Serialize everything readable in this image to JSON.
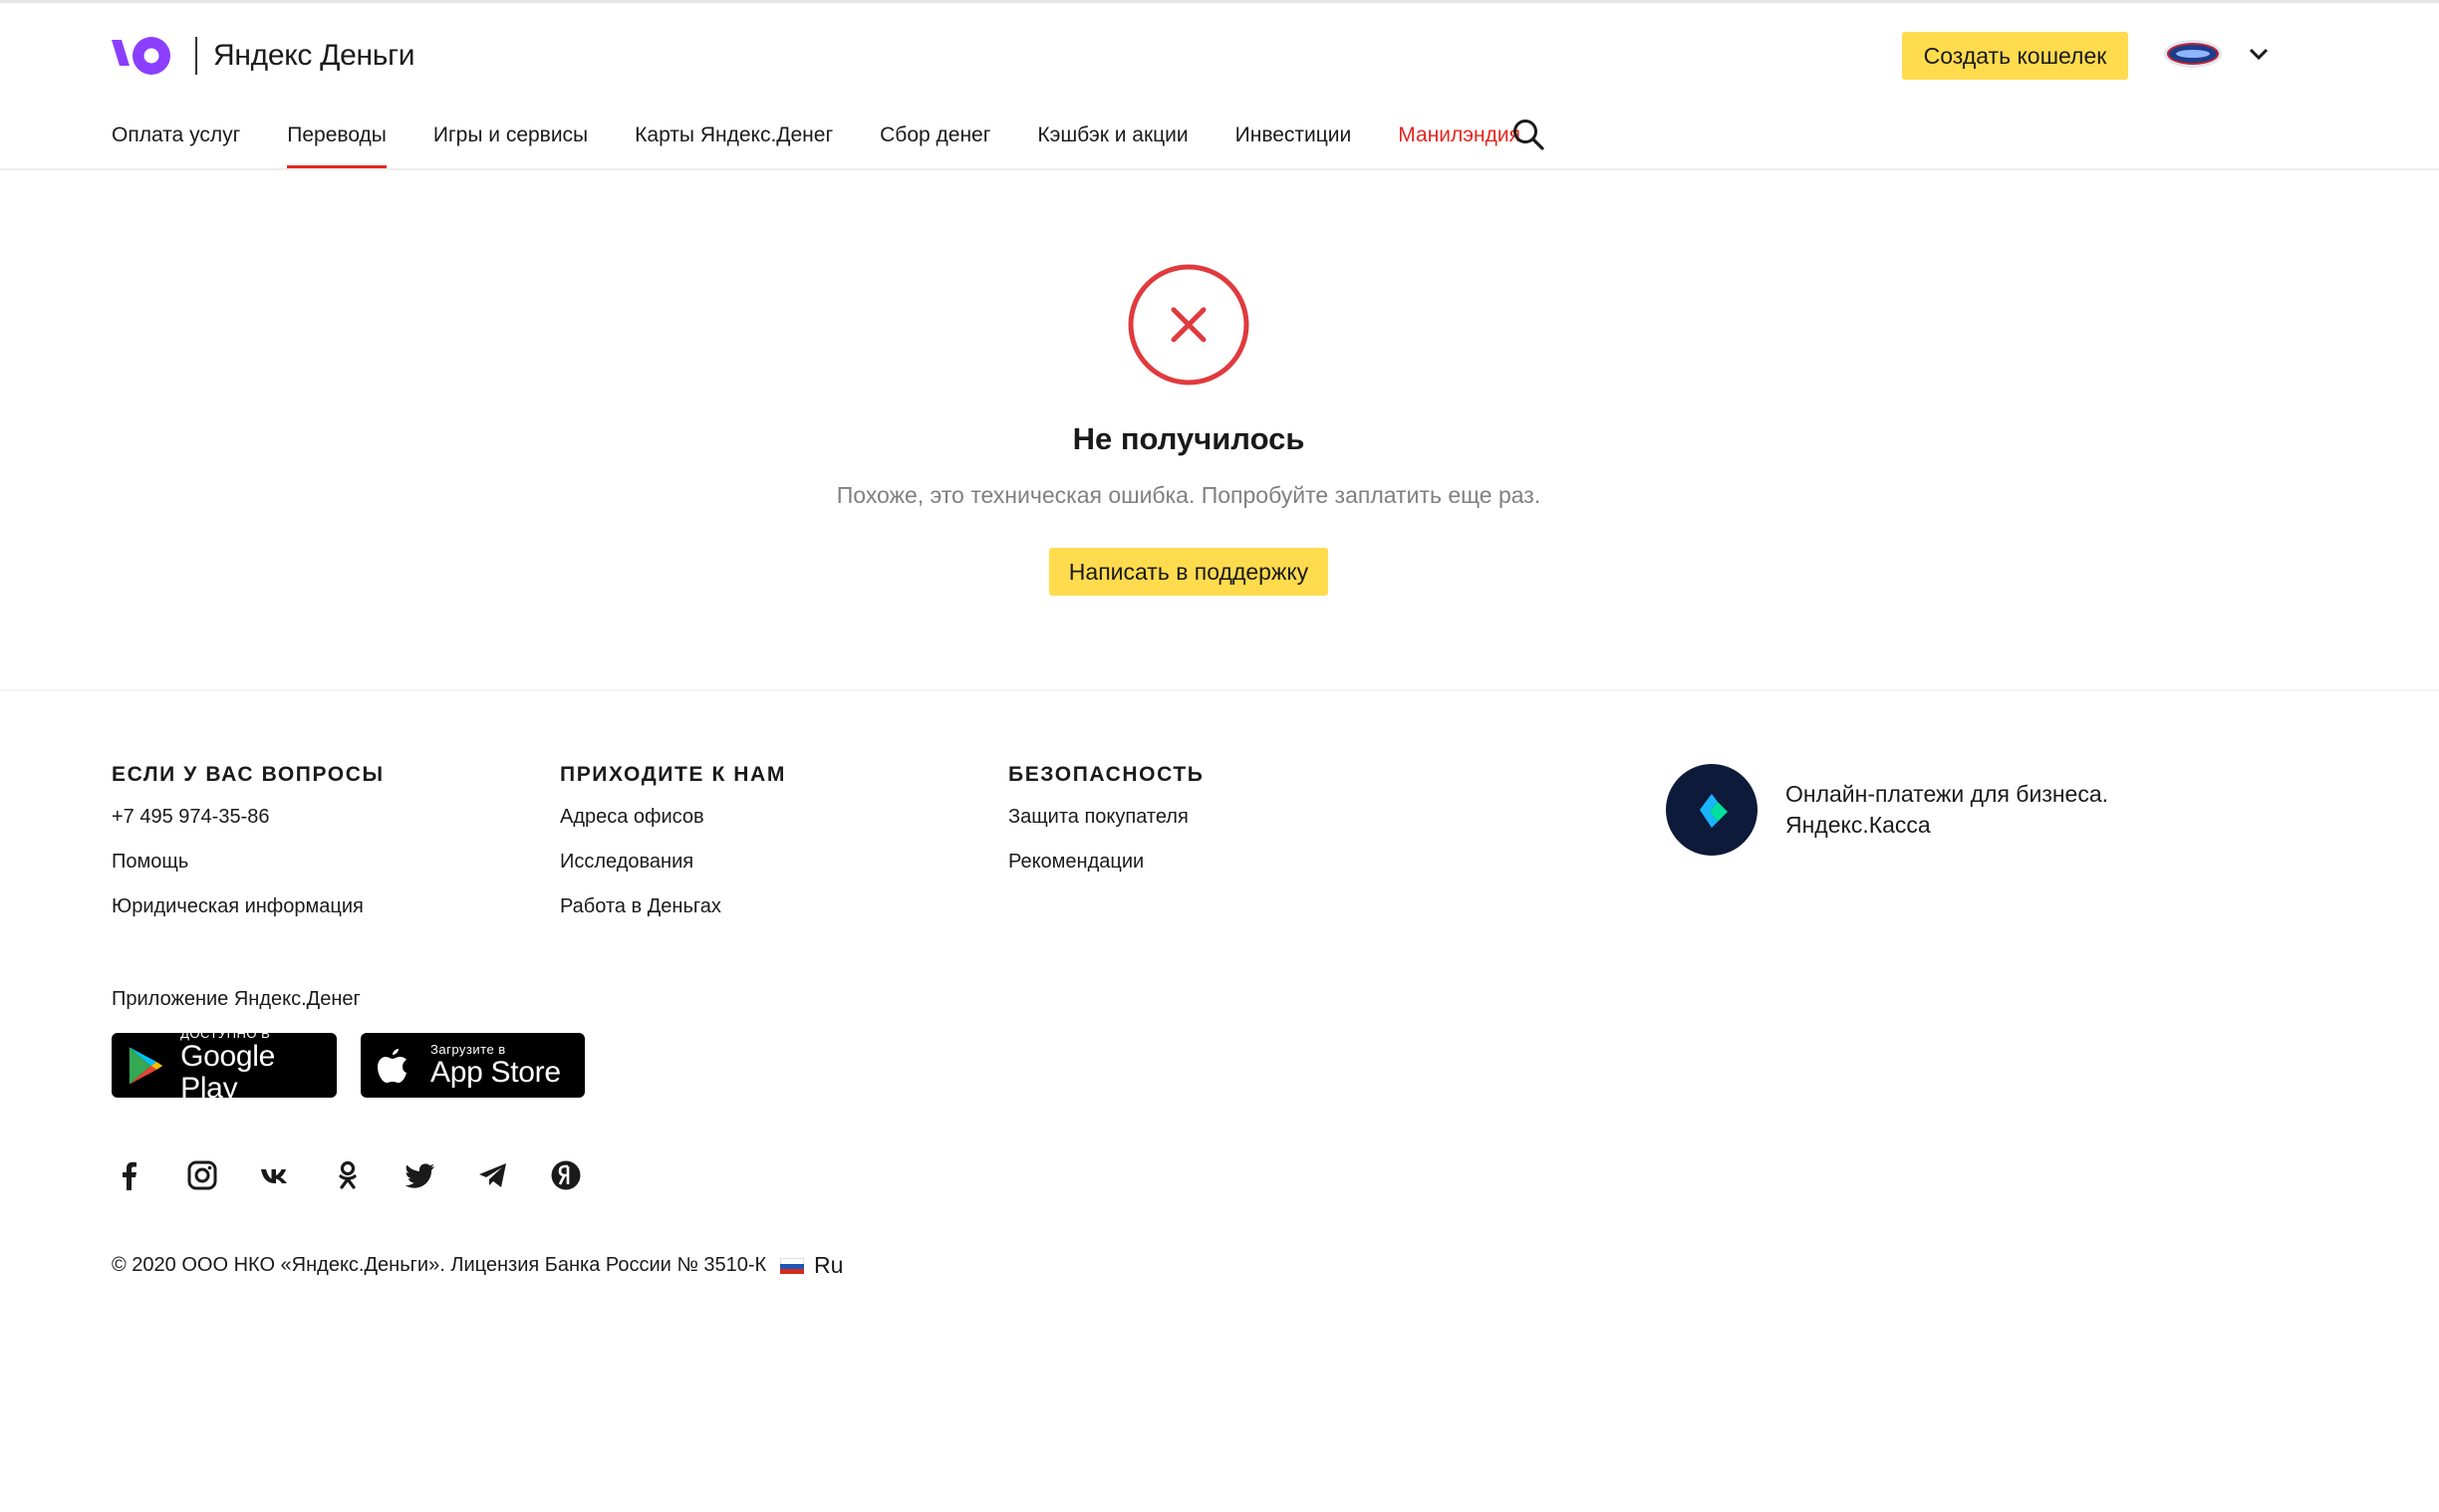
{
  "header": {
    "logo_text": "Яндекс Деньги",
    "create_wallet_label": "Создать кошелек"
  },
  "nav": {
    "items": [
      {
        "label": "Оплата услуг",
        "active": false
      },
      {
        "label": "Переводы",
        "active": true
      },
      {
        "label": "Игры и сервисы",
        "active": false
      },
      {
        "label": "Карты Яндекс.Денег",
        "active": false
      },
      {
        "label": "Сбор денег",
        "active": false
      },
      {
        "label": "Кэшбэк и акции",
        "active": false
      },
      {
        "label": "Инвестиции",
        "active": false
      },
      {
        "label": "Манилэндия",
        "active": false,
        "promo": true
      }
    ]
  },
  "error": {
    "title": "Не получилось",
    "subtitle": "Похоже, это техническая ошибка. Попробуйте заплатить еще раз.",
    "support_label": "Написать в поддержку"
  },
  "footer": {
    "columns": [
      {
        "title": "ЕСЛИ У ВАС ВОПРОСЫ",
        "links": [
          "+7 495 974-35-86",
          "Помощь",
          "Юридическая информация"
        ]
      },
      {
        "title": "ПРИХОДИТЕ К НАМ",
        "links": [
          "Адреса офисов",
          "Исследования",
          "Работа в Деньгах"
        ]
      },
      {
        "title": "БЕЗОПАСНОСТЬ",
        "links": [
          "Защита покупателя",
          "Рекомендации"
        ]
      }
    ],
    "kassa": {
      "line1": "Онлайн-платежи для бизнеса.",
      "line2": "Яндекс.Касса"
    },
    "app_label": "Приложение Яндекс.Денег",
    "google_play": {
      "small": "ДОСТУПНО В",
      "big": "Google Play"
    },
    "app_store": {
      "small": "Загрузите в",
      "big": "App Store"
    },
    "social": [
      "facebook-icon",
      "instagram-icon",
      "vk-icon",
      "odnoklassniki-icon",
      "twitter-icon",
      "telegram-icon",
      "yandex-zen-icon"
    ],
    "copyright": "© 2020 ООО НКО «Яндекс.Деньги». Лицензия Банка России № 3510-К",
    "lang": "Ru"
  },
  "colors": {
    "accent_yellow": "#ffdb4d",
    "brand_red": "#e52620",
    "brand_purple": "#8b3ffd",
    "error_red": "#e03a3e"
  }
}
